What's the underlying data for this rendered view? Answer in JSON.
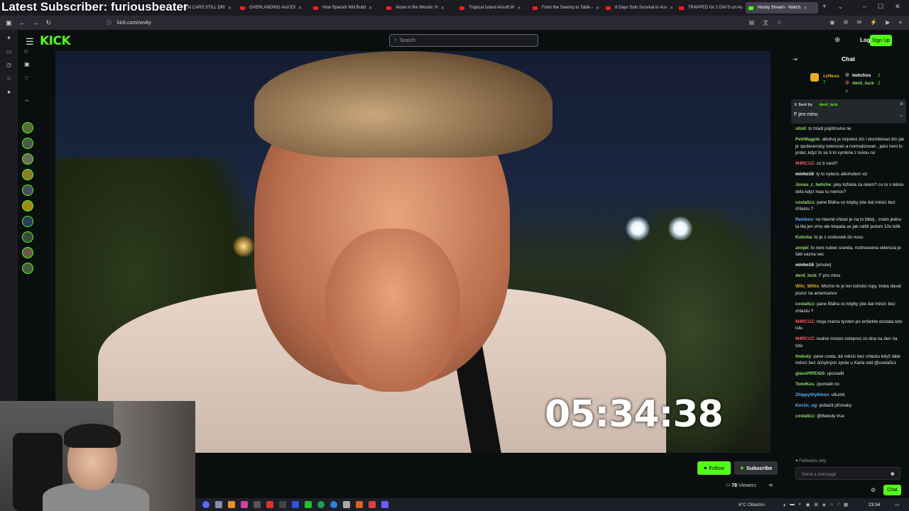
{
  "overlay": {
    "title": "Latest Subscriber: furiousbeater"
  },
  "browser": {
    "tabs": [
      {
        "label": "OKEN CARS STILL DRI"
      },
      {
        "label": "OVERLANDING And EX"
      },
      {
        "label": "How SpaceX Will Build"
      },
      {
        "label": "Alone in the Woods: H"
      },
      {
        "label": "Tropical Island Airsoft W"
      },
      {
        "label": "From the Swamp to Table -"
      },
      {
        "label": "8 Days Solo Survival in Aus"
      },
      {
        "label": "TRAPPED for 2 DAYS on Au"
      },
      {
        "label": "Novby Stream - Watch"
      }
    ],
    "url": "kick.com/novby",
    "new_tab": "+"
  },
  "site": {
    "logo": "KICK",
    "search_placeholder": "Search",
    "login": "Log In",
    "signup": "Sign Up"
  },
  "video": {
    "timer": "05:34:38"
  },
  "stream": {
    "follow": "Follow",
    "subscribe": "Subscribe",
    "viewers_count": "78",
    "viewers_label": "Viewers"
  },
  "chat": {
    "title": "Chat",
    "gifters": [
      {
        "name": "czHeso",
        "count": "7"
      },
      {
        "name": "twitchos",
        "count": "2"
      },
      {
        "name": "derd_luck",
        "count": "2"
      }
    ],
    "pinned": {
      "sent_by": "Sent by",
      "user": "derd_luck",
      "message": "F pro minu"
    },
    "messages": [
      {
        "user": "sitoll",
        "text": "to hradi pojišťovna ne",
        "color": "#8fe06b"
      },
      {
        "user": "PetrMagpie",
        "text": "alkohoj je nejvetsi zlo i vkombinaci tim jak je spolecensky tolerovan a normalizovan...jako neni to prdel, kdyz to se ti to vymkne z rukou no",
        "color": "#8fe06b"
      },
      {
        "user": "M4RCUZ",
        "text": "co ti nasil?",
        "color": "#ff5a5a"
      },
      {
        "user": "minho16",
        "text": "ty to vylecis alkoholem xd",
        "color": "#ffffff"
      },
      {
        "user": "Jonas_z_twitche",
        "text": "jaky ložiska za okem? co to s tebou dela kdyz mas tu nemoc?",
        "color": "#8fe06b"
      },
      {
        "user": "costa5cz",
        "text": "pane Bláha co kdyby jste dal měsíc bez chlastu ?",
        "color": "#8fe06b"
      },
      {
        "user": "Remkoo",
        "text": "no hlavně chlast je na to blbej , znám jednu ta lila jen víno ale klepala se jak ratlík potom 10x tolik",
        "color": "#5ab4ff"
      },
      {
        "user": "Kubsha",
        "text": "to je z voskovek do nosu",
        "color": "#8fe06b"
      },
      {
        "user": "annjel",
        "text": "to neni vubec sranda, roztrousena skleroza je fakt vazna vec",
        "color": "#8fe06b"
      },
      {
        "user": "minho16",
        "text": "[emote]",
        "color": "#ffffff"
      },
      {
        "user": "derd_luck",
        "text": "F pro minu",
        "color": "#8fe06b"
      },
      {
        "user": "Wilo_Willis",
        "text": "Mozno to je len lozisko ropy, treba davat pozor na americanov",
        "color": "#e8b020"
      },
      {
        "user": "costa5cz",
        "text": "pane Bláha co kdyby jste dal měsíc bez chlastu ?",
        "color": "#8fe06b"
      },
      {
        "user": "M4RCUZ",
        "text": "moja mama tyzden po enfarkte dostala toto iste.",
        "color": "#ff5a5a"
      },
      {
        "user": "M4RCUZ",
        "text": "realne mozes oslepnut zo dna na den na toto",
        "color": "#ff5a5a"
      },
      {
        "user": "thekoly",
        "text": "pane costa, dá měsíc bez chlastu když dáte měsíc bez úchylných zpráv u Karla xdd @costa5cz",
        "color": "#8fe06b"
      },
      {
        "user": "glassPIPE420",
        "text": "upozadit",
        "color": "#8fe06b"
      },
      {
        "user": "TomiKes",
        "text": "zpomalit no",
        "color": "#8fe06b"
      },
      {
        "user": "ZhippyStyllmon",
        "text": "utlumit",
        "color": "#5ab4ff"
      },
      {
        "user": "Kev1n_og",
        "text": "potlačit příznaky",
        "color": "#5ab4ff"
      },
      {
        "user": "costa5cz",
        "text": "@thekoly true",
        "color": "#8fe06b"
      }
    ],
    "followers_only": "Followers only",
    "send_placeholder": "Send a message",
    "send_button": "Chat"
  },
  "taskbar": {
    "weather": "6°C  Oblačno",
    "time": "23:34"
  }
}
